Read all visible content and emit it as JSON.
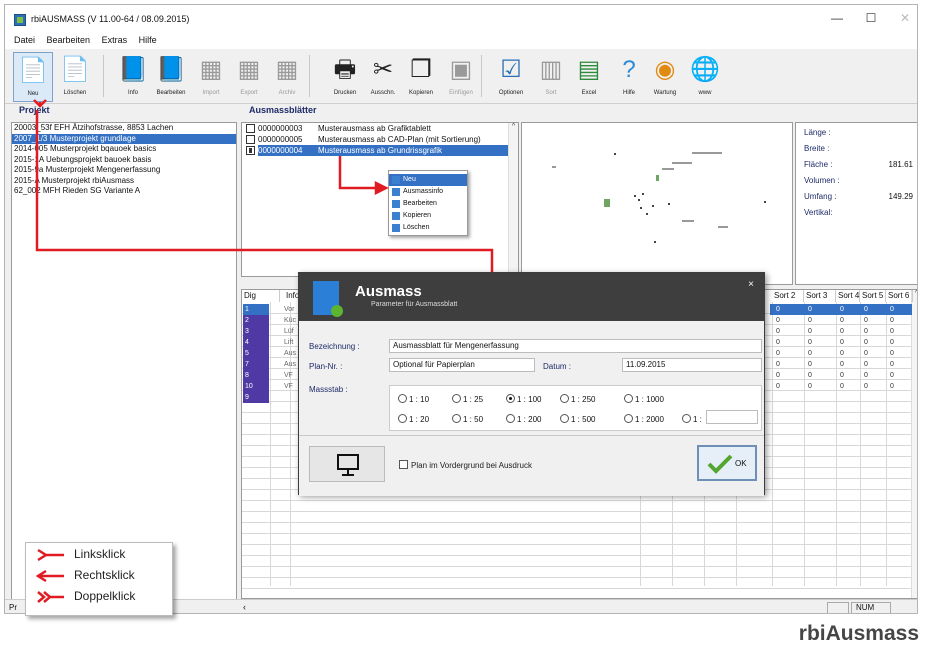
{
  "window": {
    "title": "rbiAUSMASS (V 11.00-64 / 08.09.2015)",
    "controls": [
      "—",
      "☐",
      "✕"
    ]
  },
  "menu": [
    "Datei",
    "Bearbeiten",
    "Extras",
    "Hilfe"
  ],
  "toolbar": [
    {
      "label": "Neu",
      "icon": "new-doc-icon",
      "glyph": "📄",
      "enabled": true,
      "selected": true
    },
    {
      "label": "Löschen",
      "icon": "delete-doc-icon",
      "glyph": "📄",
      "enabled": true
    },
    {
      "label": "Info",
      "icon": "info-doc-icon",
      "glyph": "📘",
      "enabled": true
    },
    {
      "label": "Bearbeiten",
      "icon": "edit-doc-icon",
      "glyph": "📘",
      "enabled": true
    },
    {
      "label": "Import",
      "icon": "import-icon",
      "glyph": "▦",
      "enabled": false
    },
    {
      "label": "Export",
      "icon": "export-icon",
      "glyph": "▦",
      "enabled": false
    },
    {
      "label": "Archiv",
      "icon": "archive-icon",
      "glyph": "▦",
      "enabled": false
    },
    {
      "label": "Drucken",
      "icon": "printer-icon",
      "glyph": "🖶",
      "enabled": true
    },
    {
      "label": "Ausschn.",
      "icon": "scissors-icon",
      "glyph": "✂",
      "enabled": true
    },
    {
      "label": "Kopieren",
      "icon": "copy-icon",
      "glyph": "❐",
      "enabled": true
    },
    {
      "label": "Einfügen",
      "icon": "paste-icon",
      "glyph": "▣",
      "enabled": false
    },
    {
      "label": "Optionen",
      "icon": "checklist-icon",
      "glyph": "☑",
      "enabled": true
    },
    {
      "label": "Sort",
      "icon": "sort-icon",
      "glyph": "▥",
      "enabled": false
    },
    {
      "label": "Excel",
      "icon": "excel-icon",
      "glyph": "▤",
      "enabled": true
    },
    {
      "label": "Hilfe",
      "icon": "help-icon",
      "glyph": "?",
      "enabled": true
    },
    {
      "label": "Wartung",
      "icon": "maintenance-icon",
      "glyph": "◉",
      "enabled": true
    },
    {
      "label": "www",
      "icon": "globe-icon",
      "glyph": "🌐",
      "enabled": true
    }
  ],
  "headers": {
    "projects": "Projekt",
    "sheets": "Ausmassblätter"
  },
  "projects": [
    {
      "text": "20003_53f EFH Ätzihofstrasse, 8853 Lachen",
      "selected": false
    },
    {
      "text": "2007_1/3 Musterprojekt grundlage",
      "selected": true
    },
    {
      "text": "2014-005 Musterprojekt bqauoek basics",
      "selected": false
    },
    {
      "text": "2015-1A  Uebungsprojekt bauoek basis",
      "selected": false
    },
    {
      "text": "2015-9a  Musterprojekt Mengenerfassung",
      "selected": false
    },
    {
      "text": "2015-A   Musterprojekt rbiAusmass",
      "selected": false
    },
    {
      "text": "62_002  MFH Rieden SG Variante A",
      "selected": false
    }
  ],
  "sheets": [
    {
      "no": "0000000003",
      "name": "Musterausmass ab Grafiktablett",
      "checked": false,
      "selected": false
    },
    {
      "no": "0000000005",
      "name": "Musterausmass ab CAD-Plan (mit Sortierung)",
      "checked": false,
      "selected": false
    },
    {
      "no": "0000000004",
      "name": "Musterausmass ab Grundrissgrafik",
      "checked": true,
      "selected": true
    }
  ],
  "context_menu": [
    {
      "label": "Neu",
      "selected": true
    },
    {
      "label": "Ausmassinfo",
      "selected": false
    },
    {
      "label": "Bearbeiten",
      "selected": false
    },
    {
      "label": "Kopieren",
      "selected": false
    },
    {
      "label": "Löschen",
      "selected": false
    }
  ],
  "info_panel": [
    {
      "label": "Länge :",
      "value": ""
    },
    {
      "label": "Breite :",
      "value": ""
    },
    {
      "label": "Fläche :",
      "value": "181.61"
    },
    {
      "label": "Volumen :",
      "value": ""
    },
    {
      "label": "Umfang :",
      "value": "149.29"
    },
    {
      "label": "Vertikal:",
      "value": ""
    }
  ],
  "grid": {
    "columns_left": [
      "Dig",
      "Info"
    ],
    "columns_right": [
      "Sort 2",
      "Sort 3",
      "Sort 4",
      "Sort 5",
      "Sort 6"
    ],
    "dig_rows": [
      "1",
      "2",
      "3",
      "4",
      "5",
      "7",
      "8",
      "10",
      "9"
    ],
    "info_rows": [
      "Vor",
      "Küc",
      "Lüf",
      "Lift",
      "Aus",
      "Aus",
      "VF",
      "VF"
    ],
    "sort_value": "0"
  },
  "dialog": {
    "title": "Ausmass",
    "subtitle": "Parameter für Ausmassblatt",
    "close": "×",
    "bezeichnung_label": "Bezeichnung :",
    "bezeichnung_value": "Ausmassblatt für Mengenerfassung",
    "plan_label": "Plan-Nr. :",
    "plan_value": "Optional für Papierplan",
    "datum_label": "Datum :",
    "datum_value": "11.09.2015",
    "massstab_label": "Massstab :",
    "scales_row1": [
      {
        "label": "1 : 10",
        "on": false
      },
      {
        "label": "1 : 25",
        "on": false
      },
      {
        "label": "1 : 100",
        "on": true
      },
      {
        "label": "1 : 250",
        "on": false
      },
      {
        "label": "1 : 1000",
        "on": false
      }
    ],
    "scales_row2": [
      {
        "label": "1 : 20",
        "on": false
      },
      {
        "label": "1 : 50",
        "on": false
      },
      {
        "label": "1 : 200",
        "on": false
      },
      {
        "label": "1 : 500",
        "on": false
      },
      {
        "label": "1 : 2000",
        "on": false
      },
      {
        "label": "1 :",
        "on": false
      }
    ],
    "checkbox_label": "Plan im Vordergrund bei Ausdruck",
    "ok_label": "OK"
  },
  "status": {
    "left": "Pr",
    "num": "NUM"
  },
  "legend": [
    {
      "label": "Linksklick",
      "marker": "left-click"
    },
    {
      "label": "Rechtsklick",
      "marker": "right-click"
    },
    {
      "label": "Doppelklick",
      "marker": "double-click"
    }
  ],
  "brand": "rbiAusmass",
  "colors": {
    "selection": "#3470c4",
    "arrow": "#e11b22",
    "dialog_header": "#3e3e3e",
    "dig_cell": "#4f3aa5"
  }
}
